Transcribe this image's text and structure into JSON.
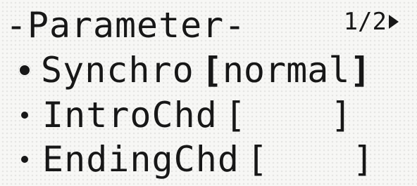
{
  "screen": {
    "title": "-Parameter-",
    "page_indicator": "1/2"
  },
  "items": [
    {
      "label": "Synchro",
      "bracket_open": "[",
      "value": "normal",
      "bracket_close": "]",
      "selected": true
    },
    {
      "label": "IntroChd",
      "bracket_open": "[",
      "value": "    ",
      "bracket_close": "]",
      "selected": false
    },
    {
      "label": "EndingChd",
      "bracket_open": "[",
      "value": "    ",
      "bracket_close": "]",
      "selected": false
    }
  ],
  "colors": {
    "lcd_background": "#f7f7f5",
    "pixel_dark": "#171717"
  }
}
